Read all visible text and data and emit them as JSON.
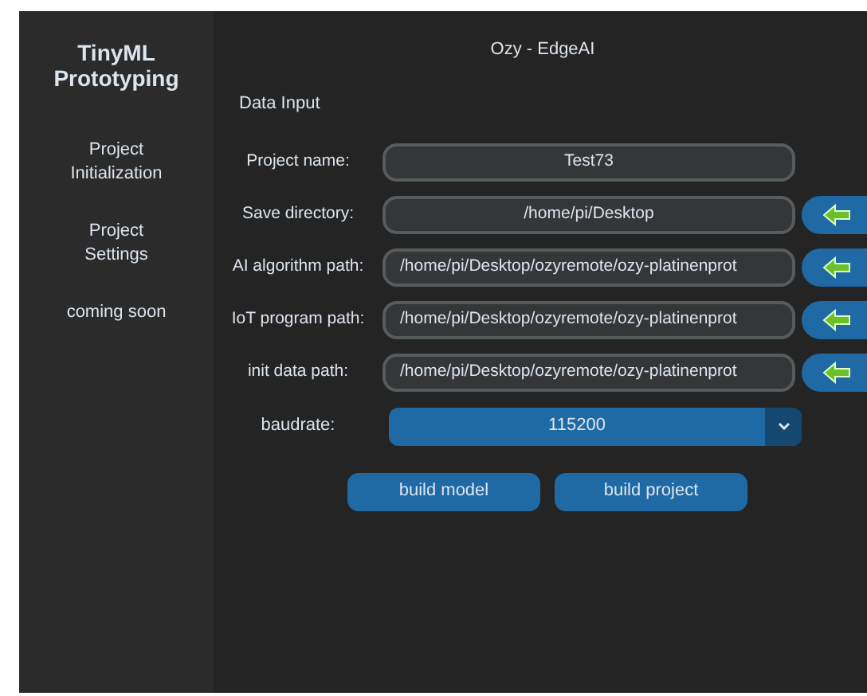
{
  "sidebar": {
    "title": "TinyML Prototyping",
    "items": [
      {
        "label": "Project Initialization"
      },
      {
        "label": "Project Settings"
      },
      {
        "label": "coming soon"
      }
    ]
  },
  "main": {
    "title": "Ozy - EdgeAI",
    "section": "Data Input",
    "fields": [
      {
        "label": "Project name:",
        "value": "Test73",
        "kind": "name"
      },
      {
        "label": "Save directory:",
        "value": "/home/pi/Desktop",
        "kind": "directory"
      },
      {
        "label": "AI algorithm path:",
        "value": "/home/pi/Desktop/ozyremote/ozy-platinenprot",
        "kind": "path"
      },
      {
        "label": "IoT program path:",
        "value": "/home/pi/Desktop/ozyremote/ozy-platinenprot",
        "kind": "path"
      },
      {
        "label": "init data path:",
        "value": "/home/pi/Desktop/ozyremote/ozy-platinenprot",
        "kind": "path"
      }
    ],
    "baudrate": {
      "label": "baudrate:",
      "value": "115200"
    },
    "buttons": [
      "build model",
      "build project"
    ]
  }
}
